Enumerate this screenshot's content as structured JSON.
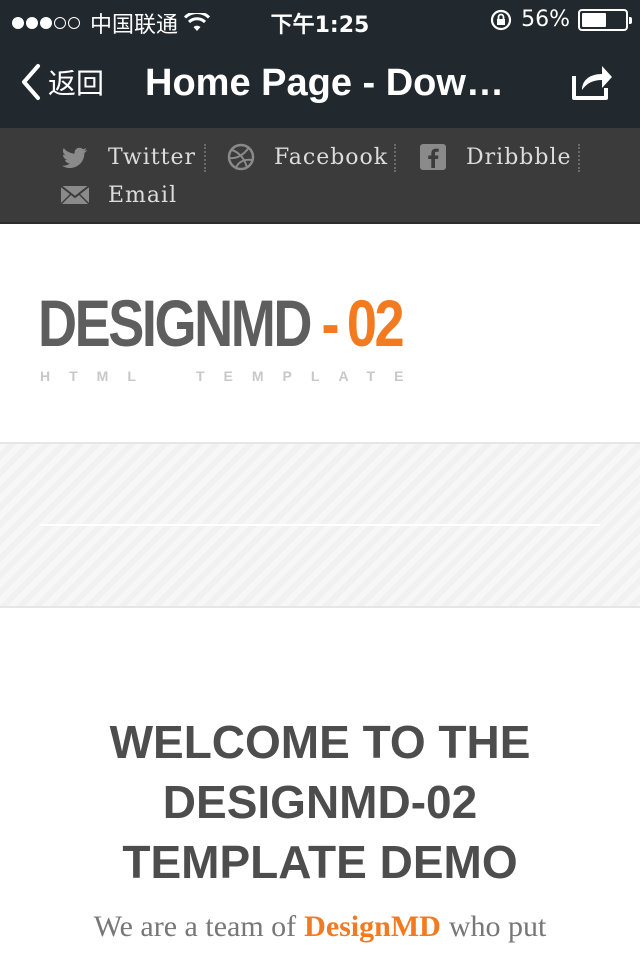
{
  "status_bar": {
    "carrier": "中国联通",
    "time": "下午1:25",
    "battery_percent_label": "56%",
    "battery_level": 0.56,
    "icons": [
      "signal-dots-icon",
      "wifi-icon",
      "rotation-lock-icon",
      "battery-icon"
    ]
  },
  "nav": {
    "back_label": "返回",
    "title": "Home Page - Dow…",
    "icons": [
      "chevron-left-icon",
      "share-icon"
    ]
  },
  "social": {
    "items": [
      {
        "label": "Twitter",
        "icon": "twitter-bird-icon"
      },
      {
        "label": "Facebook",
        "icon": "dribbble-ball-icon"
      },
      {
        "label": "Dribbble",
        "icon": "facebook-f-icon"
      },
      {
        "label": "Email",
        "icon": "envelope-icon"
      }
    ]
  },
  "logo": {
    "brand": "DESIGNMD",
    "dash": "-",
    "number": "02",
    "sub_left": "HTML",
    "sub_right": "TEMPLATE",
    "colors": {
      "brand": "#5e5e5e",
      "accent": "#f47a20"
    }
  },
  "content": {
    "welcome_line1": "WELCOME TO THE",
    "welcome_line2": "DESIGNMD-02",
    "welcome_line3": "TEMPLATE DEMO",
    "intro_before": "We are a team of",
    "intro_highlight": "DesignMD",
    "intro_after": "who put"
  },
  "colors": {
    "chrome": "#22292e",
    "social_bar": "#3b3b3b",
    "accent": "#f47a20",
    "heading": "#4d4d4d"
  }
}
